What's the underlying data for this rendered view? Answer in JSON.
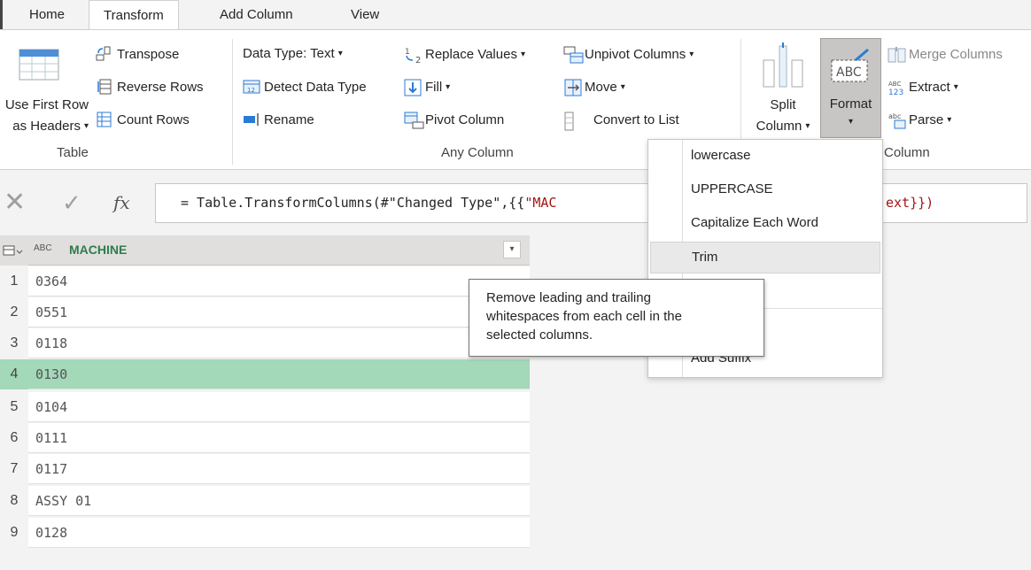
{
  "tabs": [
    "Home",
    "Transform",
    "Add Column",
    "View"
  ],
  "ribbon": {
    "table": {
      "use_first_row_l1": "Use First Row",
      "use_first_row_l2": "as Headers",
      "transpose": "Transpose",
      "reverse_rows": "Reverse Rows",
      "count_rows": "Count Rows",
      "group_label": "Table"
    },
    "any_column": {
      "data_type": "Data Type: Text",
      "detect_data_type": "Detect Data Type",
      "rename": "Rename",
      "replace_values": "Replace Values",
      "fill": "Fill",
      "pivot_column": "Pivot Column",
      "unpivot_columns": "Unpivot Columns",
      "move": "Move",
      "convert_to_list": "Convert to List",
      "group_label": "Any Column"
    },
    "text_column": {
      "split_l1": "Split",
      "split_l2": "Column",
      "format": "Format",
      "merge_columns": "Merge Columns",
      "extract": "Extract",
      "parse": "Parse",
      "group_label": "Column"
    }
  },
  "formula": {
    "text_prefix": "= Table.TransformColumns(#\"Changed Type\",{{",
    "text_red": "\"MAC",
    "text_suffix": "ext}})",
    "fx": "fx"
  },
  "table": {
    "column_type": "ABC",
    "column_header": "MACHINE",
    "rows": [
      {
        "n": "1",
        "v": "0364"
      },
      {
        "n": "2",
        "v": "0551"
      },
      {
        "n": "3",
        "v": "0118"
      },
      {
        "n": "4",
        "v": "0130"
      },
      {
        "n": "5",
        "v": "0104"
      },
      {
        "n": "6",
        "v": "0111"
      },
      {
        "n": "7",
        "v": "0117"
      },
      {
        "n": "8",
        "v": "ASSY 01"
      },
      {
        "n": "9",
        "v": "0128"
      }
    ]
  },
  "format_menu": {
    "items": [
      "lowercase",
      "UPPERCASE",
      "Capitalize Each Word",
      "Trim"
    ],
    "partial_item": "Add Suffix"
  },
  "tooltip": {
    "line1": "Remove leading and trailing",
    "line2": "whitespaces from each cell in the",
    "line3": "selected columns."
  },
  "colors": {
    "accent": "#2e7d4f",
    "selected_row": "#a3d8b9",
    "formula_red": "#a31515"
  }
}
